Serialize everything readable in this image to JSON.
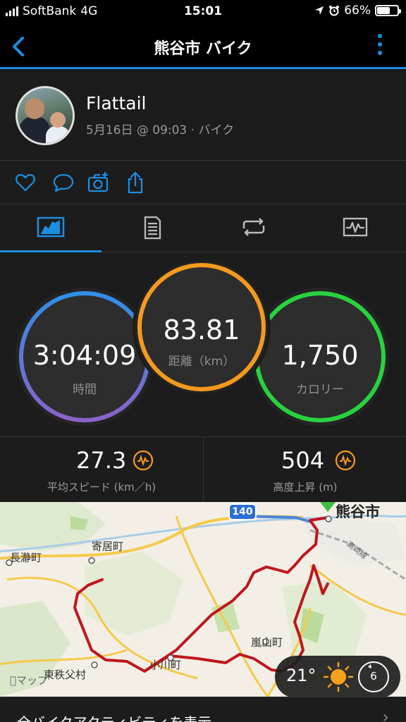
{
  "status_bar": {
    "carrier": "SoftBank",
    "network": "4G",
    "time": "15:01",
    "battery": "66%",
    "battery_level": 0.66
  },
  "nav": {
    "title": "熊谷市 バイク",
    "back_icon": "chevron-left-icon",
    "more_icon": "vertical-dots-icon"
  },
  "activity": {
    "user": "Flattail",
    "subtitle": "5月16日 @ 09:03 · バイク"
  },
  "actions": [
    "heart-icon",
    "comment-icon",
    "camera-add-icon",
    "share-icon"
  ],
  "tabs": [
    {
      "icon": "overview-icon",
      "active": true
    },
    {
      "icon": "details-icon",
      "active": false
    },
    {
      "icon": "laps-icon",
      "active": false
    },
    {
      "icon": "chart-icon",
      "active": false
    }
  ],
  "stats": {
    "time": {
      "value": "3:04:09",
      "label": "時間"
    },
    "distance": {
      "value": "83.81",
      "label": "距離（km）"
    },
    "calories": {
      "value": "1,750",
      "label": "カロリー"
    }
  },
  "sub_stats": {
    "avg_speed": {
      "value": "27.3",
      "label": "平均スピード (km／h)"
    },
    "elevation": {
      "value": "504",
      "label": "高度上昇 (m)"
    }
  },
  "map": {
    "labels": {
      "kumagaya": "熊谷市",
      "yorii": "寄居町",
      "nagatoro": "長瀞町",
      "ranzan": "嵐山町",
      "ogawa": "小川町",
      "higashichichibu": "東秩父村",
      "takasaki_line": "高崎線",
      "route": "140"
    },
    "attribution": "マップ",
    "weather": {
      "temp": "21°",
      "wind": "6"
    }
  },
  "footer": {
    "link": "全バイクアクティビティを表示"
  },
  "colors": {
    "accent": "#1c8ee0",
    "time_ring": "#6f6fd8",
    "distance_ring": "#f39a1e",
    "calories_ring": "#27d33d",
    "route": "#c0161c"
  }
}
